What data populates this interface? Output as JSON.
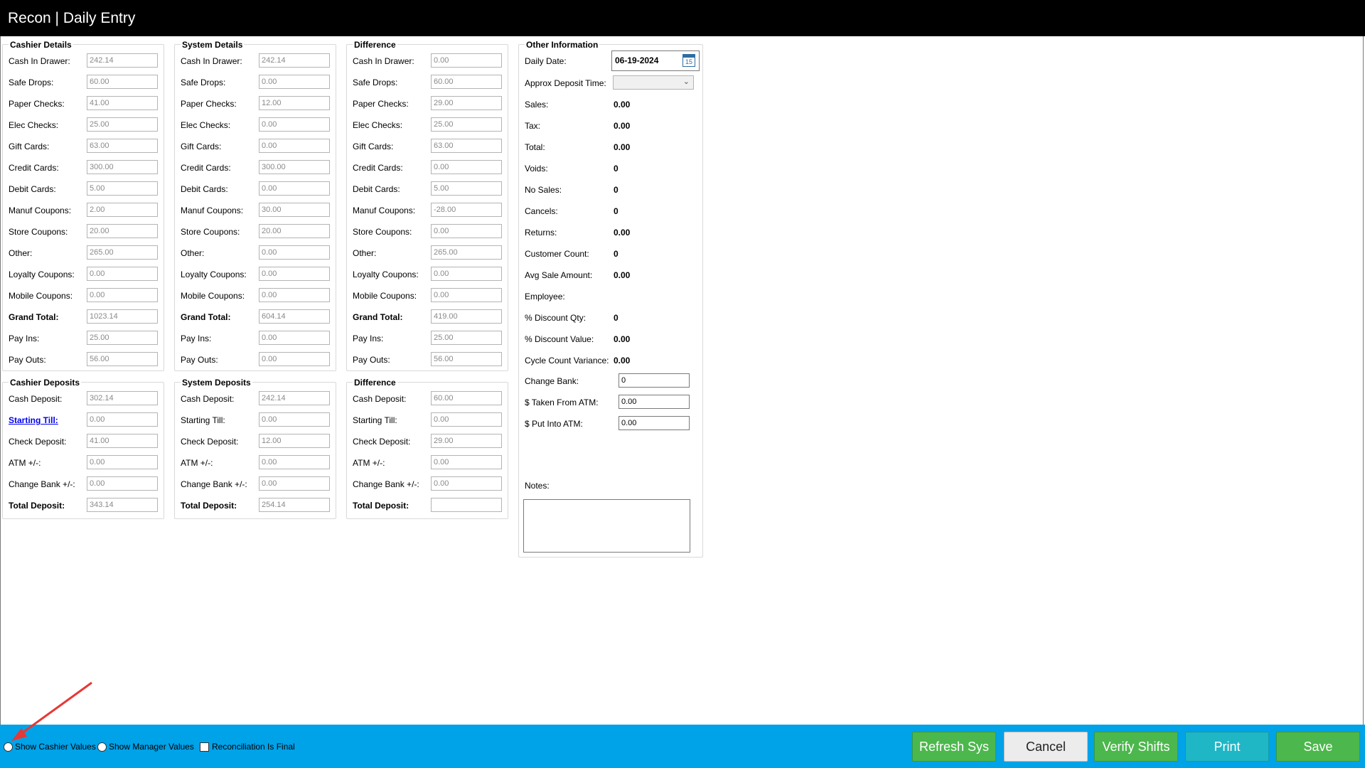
{
  "window": {
    "title": "Recon | Daily Entry"
  },
  "cashier_details": {
    "title": "Cashier Details",
    "rows": [
      {
        "label": "Cash In Drawer:",
        "value": "242.14"
      },
      {
        "label": "Safe Drops:",
        "value": "60.00"
      },
      {
        "label": "Paper Checks:",
        "value": "41.00"
      },
      {
        "label": "Elec Checks:",
        "value": "25.00"
      },
      {
        "label": "Gift Cards:",
        "value": "63.00"
      },
      {
        "label": "Credit Cards:",
        "value": "300.00"
      },
      {
        "label": "Debit Cards:",
        "value": "5.00"
      },
      {
        "label": "Manuf Coupons:",
        "value": "2.00"
      },
      {
        "label": "Store Coupons:",
        "value": "20.00"
      },
      {
        "label": "Other:",
        "value": "265.00"
      },
      {
        "label": "Loyalty Coupons:",
        "value": "0.00"
      },
      {
        "label": "Mobile Coupons:",
        "value": "0.00"
      },
      {
        "label": "Grand Total:",
        "value": "1023.14"
      },
      {
        "label": "Pay Ins:",
        "value": "25.00"
      },
      {
        "label": "Pay Outs:",
        "value": "56.00"
      }
    ]
  },
  "system_details": {
    "title": "System Details",
    "rows": [
      {
        "label": "Cash In Drawer:",
        "value": "242.14"
      },
      {
        "label": "Safe Drops:",
        "value": "0.00"
      },
      {
        "label": "Paper Checks:",
        "value": "12.00"
      },
      {
        "label": "Elec Checks:",
        "value": "0.00"
      },
      {
        "label": "Gift Cards:",
        "value": "0.00"
      },
      {
        "label": "Credit Cards:",
        "value": "300.00"
      },
      {
        "label": "Debit Cards:",
        "value": "0.00"
      },
      {
        "label": "Manuf Coupons:",
        "value": "30.00"
      },
      {
        "label": "Store Coupons:",
        "value": "20.00"
      },
      {
        "label": "Other:",
        "value": "0.00"
      },
      {
        "label": "Loyalty Coupons:",
        "value": "0.00"
      },
      {
        "label": "Mobile Coupons:",
        "value": "0.00"
      },
      {
        "label": "Grand Total:",
        "value": "604.14"
      },
      {
        "label": "Pay Ins:",
        "value": "0.00"
      },
      {
        "label": "Pay Outs:",
        "value": "0.00"
      }
    ]
  },
  "difference_details": {
    "title": "Difference",
    "rows": [
      {
        "label": "Cash In Drawer:",
        "value": "0.00"
      },
      {
        "label": "Safe Drops:",
        "value": "60.00"
      },
      {
        "label": "Paper Checks:",
        "value": "29.00"
      },
      {
        "label": "Elec Checks:",
        "value": "25.00"
      },
      {
        "label": "Gift Cards:",
        "value": "63.00"
      },
      {
        "label": "Credit Cards:",
        "value": "0.00"
      },
      {
        "label": "Debit Cards:",
        "value": "5.00"
      },
      {
        "label": "Manuf Coupons:",
        "value": "-28.00"
      },
      {
        "label": "Store Coupons:",
        "value": "0.00"
      },
      {
        "label": "Other:",
        "value": "265.00"
      },
      {
        "label": "Loyalty Coupons:",
        "value": "0.00"
      },
      {
        "label": "Mobile Coupons:",
        "value": "0.00"
      },
      {
        "label": "Grand Total:",
        "value": "419.00"
      },
      {
        "label": "Pay Ins:",
        "value": "25.00"
      },
      {
        "label": "Pay Outs:",
        "value": "56.00"
      }
    ]
  },
  "cashier_deposits": {
    "title": "Cashier Deposits",
    "rows": [
      {
        "label": "Cash Deposit:",
        "value": "302.14"
      },
      {
        "label": "Starting Till:",
        "value": "0.00"
      },
      {
        "label": "Check Deposit:",
        "value": "41.00"
      },
      {
        "label": "ATM +/-:",
        "value": "0.00"
      },
      {
        "label": "Change Bank +/-:",
        "value": "0.00"
      },
      {
        "label": "Total Deposit:",
        "value": "343.14"
      }
    ]
  },
  "system_deposits": {
    "title": "System Deposits",
    "rows": [
      {
        "label": "Cash Deposit:",
        "value": "242.14"
      },
      {
        "label": "Starting Till:",
        "value": "0.00"
      },
      {
        "label": "Check Deposit:",
        "value": "12.00"
      },
      {
        "label": "ATM +/-:",
        "value": "0.00"
      },
      {
        "label": "Change Bank +/-:",
        "value": "0.00"
      },
      {
        "label": "Total Deposit:",
        "value": "254.14"
      }
    ]
  },
  "difference_deposits": {
    "title": "Difference",
    "rows": [
      {
        "label": "Cash Deposit:",
        "value": "60.00"
      },
      {
        "label": "Starting Till:",
        "value": "0.00"
      },
      {
        "label": "Check Deposit:",
        "value": "29.00"
      },
      {
        "label": "ATM +/-:",
        "value": "0.00"
      },
      {
        "label": "Change Bank +/-:",
        "value": "0.00"
      },
      {
        "label": "Total Deposit:",
        "value": ""
      }
    ]
  },
  "other_info": {
    "title": "Other Information",
    "daily_date_label": "Daily Date:",
    "daily_date_value": "06-19-2024",
    "calendar_day": "15",
    "deposit_time_label": "Approx Deposit Time:",
    "deposit_time_value": "",
    "stats": [
      {
        "label": "Sales:",
        "value": "0.00"
      },
      {
        "label": "Tax:",
        "value": "0.00"
      },
      {
        "label": "Total:",
        "value": "0.00"
      },
      {
        "label": "Voids:",
        "value": "0"
      },
      {
        "label": "No Sales:",
        "value": "0"
      },
      {
        "label": "Cancels:",
        "value": "0"
      },
      {
        "label": "Returns:",
        "value": "0.00"
      },
      {
        "label": "Customer Count:",
        "value": "0"
      },
      {
        "label": "Avg Sale Amount:",
        "value": "0.00"
      },
      {
        "label": "Employee:",
        "value": ""
      },
      {
        "label": "% Discount Qty:",
        "value": "0"
      },
      {
        "label": "% Discount Value:",
        "value": "0.00"
      },
      {
        "label": "Cycle Count Variance:",
        "value": "0.00"
      }
    ],
    "inputs": [
      {
        "label": "Change Bank:",
        "value": "0"
      },
      {
        "label": "$ Taken From ATM:",
        "value": "0.00"
      },
      {
        "label": "$ Put Into ATM:",
        "value": "0.00"
      }
    ],
    "notes_label": "Notes:",
    "notes_value": ""
  },
  "footer": {
    "show_cashier_values": "Show Cashier Values",
    "show_manager_values": "Show Manager Values",
    "reconciliation_final": "Reconciliation Is Final",
    "buttons": {
      "refresh": "Refresh Sys",
      "cancel": "Cancel",
      "verify": "Verify Shifts",
      "print": "Print",
      "save": "Save"
    }
  },
  "colors": {
    "footer_bg": "#00a2e8",
    "button_green": "#4cb74c",
    "button_teal": "#1fb6c6",
    "annotation_arrow": "#e53935"
  }
}
